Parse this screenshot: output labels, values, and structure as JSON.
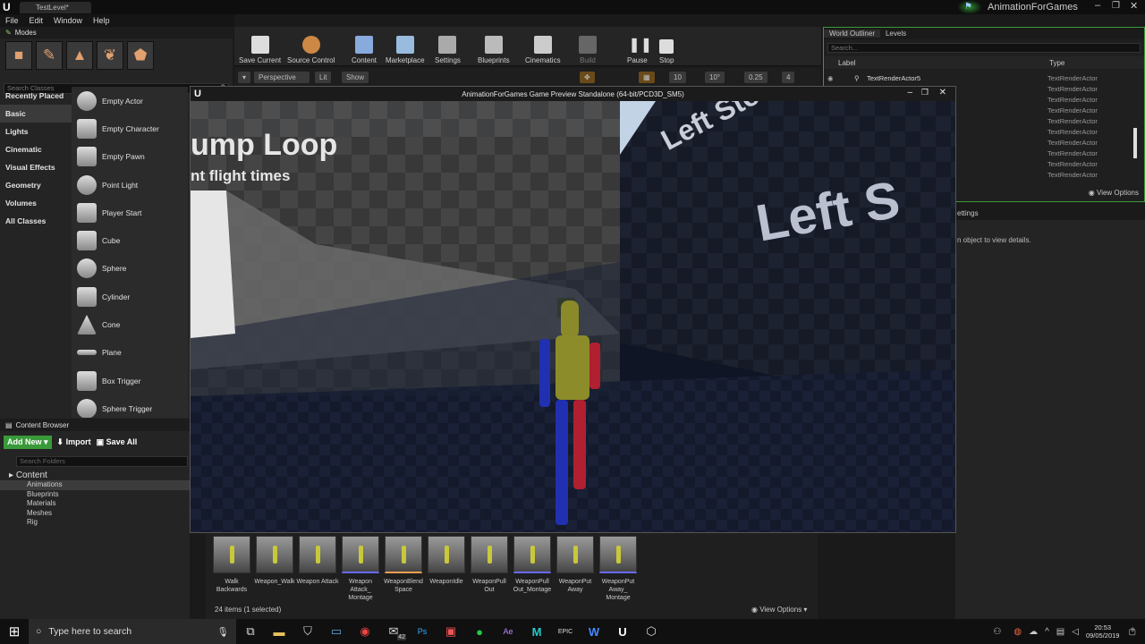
{
  "editor": {
    "tab_title": "TestLevel*",
    "brand": "AnimationForGames",
    "menu": [
      "File",
      "Edit",
      "Window",
      "Help"
    ]
  },
  "modes": {
    "title": "Modes",
    "search_placeholder": "Search Classes",
    "categories": [
      "Recently Placed",
      "Basic",
      "Lights",
      "Cinematic",
      "Visual Effects",
      "Geometry",
      "Volumes",
      "All Classes"
    ],
    "items": [
      "Empty Actor",
      "Empty Character",
      "Empty Pawn",
      "Point Light",
      "Player Start",
      "Cube",
      "Sphere",
      "Cylinder",
      "Cone",
      "Plane",
      "Box Trigger",
      "Sphere Trigger"
    ]
  },
  "toolbar": {
    "buttons": [
      "Save Current",
      "Source Control",
      "Content",
      "Marketplace",
      "Settings",
      "Blueprints",
      "Cinematics",
      "Build",
      "Pause",
      "Stop"
    ]
  },
  "viewport": {
    "perspective": "Perspective",
    "lit": "Lit",
    "show": "Show",
    "grid": "10",
    "rot": "10°",
    "scale": "0.25",
    "cams": "4"
  },
  "outliner": {
    "tab1": "World Outliner",
    "tab2": "Levels",
    "search_placeholder": "Search...",
    "col_label": "Label",
    "col_type": "Type",
    "selected": "TextRenderActor5",
    "types": [
      "TextRenderActor",
      "TextRenderActor",
      "TextRenderActor",
      "TextRenderActor",
      "TextRenderActor",
      "TextRenderActor",
      "TextRenderActor",
      "TextRenderActor",
      "TextRenderActor",
      "TextRenderActor"
    ],
    "view_options": "View Options"
  },
  "details": {
    "tab": "ettings",
    "hint": "n object to view details."
  },
  "game_window": {
    "title": "AnimationForGames Game Preview Standalone (64-bit/PCD3D_SM5)",
    "sign1_line1": "ump Loop",
    "sign1_line2": "nt flight times",
    "sign2": "Left Sto",
    "sign3": "Left S"
  },
  "content_browser": {
    "title": "Content Browser",
    "add_new": "Add New",
    "import": "Import",
    "save_all": "Save All",
    "search_placeholder": "Search Folders",
    "root": "Content",
    "folders": [
      "Animations",
      "Blueprints",
      "Materials",
      "Meshes",
      "Rig"
    ]
  },
  "assets": {
    "items": [
      "Walk Backwards",
      "Weapon_Walk",
      "Weapon Attack",
      "Weapon Attack_ Montage",
      "WeaponBlend Space",
      "WeaponIdle",
      "WeaponPull Out",
      "WeaponPull Out_Montage",
      "WeaponPut Away",
      "WeaponPut Away_ Montage"
    ],
    "count": "24 items (1 selected)",
    "view_options": "View Options"
  },
  "taskbar": {
    "search": "Type here to search",
    "time": "20:53",
    "date": "09/05/2019",
    "notif": "8",
    "badge": "42"
  }
}
